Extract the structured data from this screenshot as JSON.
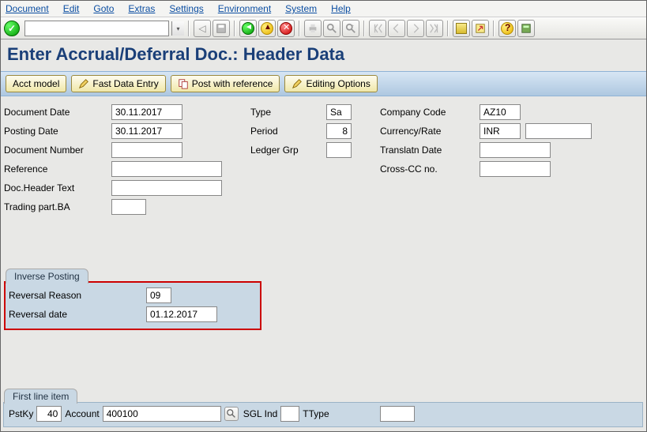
{
  "menu": {
    "document": "Document",
    "edit": "Edit",
    "goto": "Goto",
    "extras": "Extras",
    "settings": "Settings",
    "environment": "Environment",
    "system": "System",
    "help": "Help"
  },
  "command_field": "",
  "page_title": "Enter Accrual/Deferral Doc.: Header Data",
  "buttons": {
    "acct_model": "Acct model",
    "fast_data_entry": "Fast Data Entry",
    "post_with_reference": "Post with reference",
    "editing_options": "Editing Options"
  },
  "fields": {
    "document_date_label": "Document Date",
    "document_date": "30.11.2017",
    "posting_date_label": "Posting Date",
    "posting_date": "30.11.2017",
    "document_number_label": "Document Number",
    "document_number": "",
    "reference_label": "Reference",
    "reference": "",
    "doc_header_text_label": "Doc.Header Text",
    "doc_header_text": "",
    "trading_part_ba_label": "Trading part.BA",
    "trading_part_ba": "",
    "type_label": "Type",
    "type": "Sa",
    "period_label": "Period",
    "period": "8",
    "ledger_grp_label": "Ledger Grp",
    "ledger_grp": "",
    "company_code_label": "Company Code",
    "company_code": "AZ10",
    "currency_rate_label": "Currency/Rate",
    "currency": "INR",
    "rate": "",
    "translatn_date_label": "Translatn Date",
    "translatn_date": "",
    "cross_cc_label": "Cross-CC no.",
    "cross_cc": ""
  },
  "inverse": {
    "title": "Inverse Posting",
    "reversal_reason_label": "Reversal Reason",
    "reversal_reason": "09",
    "reversal_date_label": "Reversal date",
    "reversal_date": "01.12.2017"
  },
  "first_line": {
    "title": "First line item",
    "pstky_label": "PstKy",
    "pstky": "40",
    "account_label": "Account",
    "account": "400100",
    "sgl_ind_label": "SGL Ind",
    "sgl_ind": "",
    "ttype_label": "TType",
    "ttype": ""
  }
}
